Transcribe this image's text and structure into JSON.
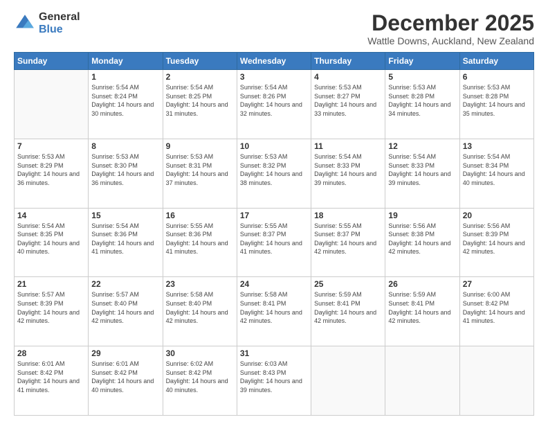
{
  "logo": {
    "general": "General",
    "blue": "Blue"
  },
  "title": "December 2025",
  "location": "Wattle Downs, Auckland, New Zealand",
  "days_header": [
    "Sunday",
    "Monday",
    "Tuesday",
    "Wednesday",
    "Thursday",
    "Friday",
    "Saturday"
  ],
  "weeks": [
    [
      {
        "day": "",
        "sunrise": "",
        "sunset": "",
        "daylight": ""
      },
      {
        "day": "1",
        "sunrise": "Sunrise: 5:54 AM",
        "sunset": "Sunset: 8:24 PM",
        "daylight": "Daylight: 14 hours and 30 minutes."
      },
      {
        "day": "2",
        "sunrise": "Sunrise: 5:54 AM",
        "sunset": "Sunset: 8:25 PM",
        "daylight": "Daylight: 14 hours and 31 minutes."
      },
      {
        "day": "3",
        "sunrise": "Sunrise: 5:54 AM",
        "sunset": "Sunset: 8:26 PM",
        "daylight": "Daylight: 14 hours and 32 minutes."
      },
      {
        "day": "4",
        "sunrise": "Sunrise: 5:53 AM",
        "sunset": "Sunset: 8:27 PM",
        "daylight": "Daylight: 14 hours and 33 minutes."
      },
      {
        "day": "5",
        "sunrise": "Sunrise: 5:53 AM",
        "sunset": "Sunset: 8:28 PM",
        "daylight": "Daylight: 14 hours and 34 minutes."
      },
      {
        "day": "6",
        "sunrise": "Sunrise: 5:53 AM",
        "sunset": "Sunset: 8:28 PM",
        "daylight": "Daylight: 14 hours and 35 minutes."
      }
    ],
    [
      {
        "day": "7",
        "sunrise": "Sunrise: 5:53 AM",
        "sunset": "Sunset: 8:29 PM",
        "daylight": "Daylight: 14 hours and 36 minutes."
      },
      {
        "day": "8",
        "sunrise": "Sunrise: 5:53 AM",
        "sunset": "Sunset: 8:30 PM",
        "daylight": "Daylight: 14 hours and 36 minutes."
      },
      {
        "day": "9",
        "sunrise": "Sunrise: 5:53 AM",
        "sunset": "Sunset: 8:31 PM",
        "daylight": "Daylight: 14 hours and 37 minutes."
      },
      {
        "day": "10",
        "sunrise": "Sunrise: 5:53 AM",
        "sunset": "Sunset: 8:32 PM",
        "daylight": "Daylight: 14 hours and 38 minutes."
      },
      {
        "day": "11",
        "sunrise": "Sunrise: 5:54 AM",
        "sunset": "Sunset: 8:33 PM",
        "daylight": "Daylight: 14 hours and 39 minutes."
      },
      {
        "day": "12",
        "sunrise": "Sunrise: 5:54 AM",
        "sunset": "Sunset: 8:33 PM",
        "daylight": "Daylight: 14 hours and 39 minutes."
      },
      {
        "day": "13",
        "sunrise": "Sunrise: 5:54 AM",
        "sunset": "Sunset: 8:34 PM",
        "daylight": "Daylight: 14 hours and 40 minutes."
      }
    ],
    [
      {
        "day": "14",
        "sunrise": "Sunrise: 5:54 AM",
        "sunset": "Sunset: 8:35 PM",
        "daylight": "Daylight: 14 hours and 40 minutes."
      },
      {
        "day": "15",
        "sunrise": "Sunrise: 5:54 AM",
        "sunset": "Sunset: 8:36 PM",
        "daylight": "Daylight: 14 hours and 41 minutes."
      },
      {
        "day": "16",
        "sunrise": "Sunrise: 5:55 AM",
        "sunset": "Sunset: 8:36 PM",
        "daylight": "Daylight: 14 hours and 41 minutes."
      },
      {
        "day": "17",
        "sunrise": "Sunrise: 5:55 AM",
        "sunset": "Sunset: 8:37 PM",
        "daylight": "Daylight: 14 hours and 41 minutes."
      },
      {
        "day": "18",
        "sunrise": "Sunrise: 5:55 AM",
        "sunset": "Sunset: 8:37 PM",
        "daylight": "Daylight: 14 hours and 42 minutes."
      },
      {
        "day": "19",
        "sunrise": "Sunrise: 5:56 AM",
        "sunset": "Sunset: 8:38 PM",
        "daylight": "Daylight: 14 hours and 42 minutes."
      },
      {
        "day": "20",
        "sunrise": "Sunrise: 5:56 AM",
        "sunset": "Sunset: 8:39 PM",
        "daylight": "Daylight: 14 hours and 42 minutes."
      }
    ],
    [
      {
        "day": "21",
        "sunrise": "Sunrise: 5:57 AM",
        "sunset": "Sunset: 8:39 PM",
        "daylight": "Daylight: 14 hours and 42 minutes."
      },
      {
        "day": "22",
        "sunrise": "Sunrise: 5:57 AM",
        "sunset": "Sunset: 8:40 PM",
        "daylight": "Daylight: 14 hours and 42 minutes."
      },
      {
        "day": "23",
        "sunrise": "Sunrise: 5:58 AM",
        "sunset": "Sunset: 8:40 PM",
        "daylight": "Daylight: 14 hours and 42 minutes."
      },
      {
        "day": "24",
        "sunrise": "Sunrise: 5:58 AM",
        "sunset": "Sunset: 8:41 PM",
        "daylight": "Daylight: 14 hours and 42 minutes."
      },
      {
        "day": "25",
        "sunrise": "Sunrise: 5:59 AM",
        "sunset": "Sunset: 8:41 PM",
        "daylight": "Daylight: 14 hours and 42 minutes."
      },
      {
        "day": "26",
        "sunrise": "Sunrise: 5:59 AM",
        "sunset": "Sunset: 8:41 PM",
        "daylight": "Daylight: 14 hours and 42 minutes."
      },
      {
        "day": "27",
        "sunrise": "Sunrise: 6:00 AM",
        "sunset": "Sunset: 8:42 PM",
        "daylight": "Daylight: 14 hours and 41 minutes."
      }
    ],
    [
      {
        "day": "28",
        "sunrise": "Sunrise: 6:01 AM",
        "sunset": "Sunset: 8:42 PM",
        "daylight": "Daylight: 14 hours and 41 minutes."
      },
      {
        "day": "29",
        "sunrise": "Sunrise: 6:01 AM",
        "sunset": "Sunset: 8:42 PM",
        "daylight": "Daylight: 14 hours and 40 minutes."
      },
      {
        "day": "30",
        "sunrise": "Sunrise: 6:02 AM",
        "sunset": "Sunset: 8:42 PM",
        "daylight": "Daylight: 14 hours and 40 minutes."
      },
      {
        "day": "31",
        "sunrise": "Sunrise: 6:03 AM",
        "sunset": "Sunset: 8:43 PM",
        "daylight": "Daylight: 14 hours and 39 minutes."
      },
      {
        "day": "",
        "sunrise": "",
        "sunset": "",
        "daylight": ""
      },
      {
        "day": "",
        "sunrise": "",
        "sunset": "",
        "daylight": ""
      },
      {
        "day": "",
        "sunrise": "",
        "sunset": "",
        "daylight": ""
      }
    ]
  ]
}
